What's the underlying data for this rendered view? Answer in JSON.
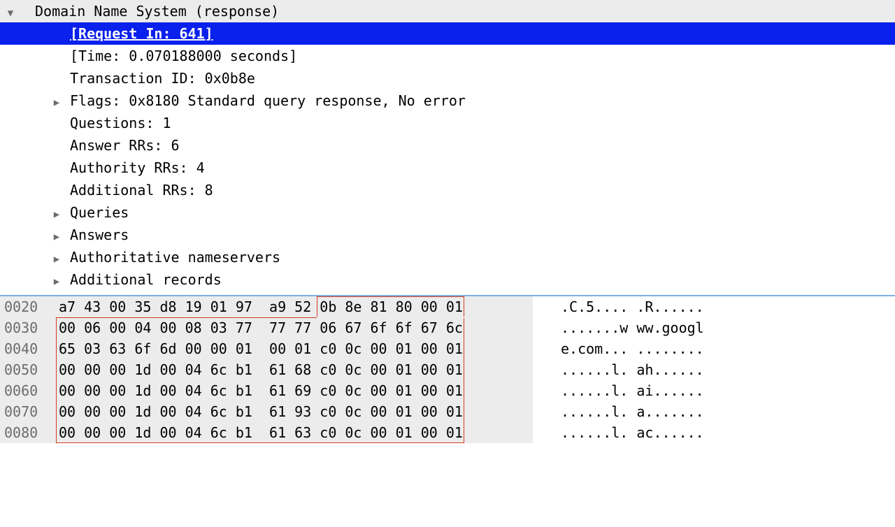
{
  "tree": {
    "header": "Domain Name System (response)",
    "request_in": "[Request In: 641]",
    "time": "[Time: 0.070188000 seconds]",
    "transaction_id": "Transaction ID: 0x0b8e",
    "flags": "Flags: 0x8180 Standard query response, No error",
    "questions": "Questions: 1",
    "answer_rrs": "Answer RRs: 6",
    "authority_rrs": "Authority RRs: 4",
    "additional_rrs": "Additional RRs: 8",
    "queries": "Queries",
    "answers": "Answers",
    "authoritative": "Authoritative nameservers",
    "additional": "Additional records"
  },
  "hex": {
    "rows": [
      {
        "offset": "0020",
        "bytes": "a7 43 00 35 d8 19 01 97  a9 52 0b 8e 81 80 00 01",
        "ascii": ".C.5.... .R......"
      },
      {
        "offset": "0030",
        "bytes": "00 06 00 04 00 08 03 77  77 77 06 67 6f 6f 67 6c",
        "ascii": ".......w ww.googl"
      },
      {
        "offset": "0040",
        "bytes": "65 03 63 6f 6d 00 00 01  00 01 c0 0c 00 01 00 01",
        "ascii": "e.com... ........"
      },
      {
        "offset": "0050",
        "bytes": "00 00 00 1d 00 04 6c b1  61 68 c0 0c 00 01 00 01",
        "ascii": "......l. ah......"
      },
      {
        "offset": "0060",
        "bytes": "00 00 00 1d 00 04 6c b1  61 69 c0 0c 00 01 00 01",
        "ascii": "......l. ai......"
      },
      {
        "offset": "0070",
        "bytes": "00 00 00 1d 00 04 6c b1  61 93 c0 0c 00 01 00 01",
        "ascii": "......l. a......."
      },
      {
        "offset": "0080",
        "bytes": "00 00 00 1d 00 04 6c b1  61 63 c0 0c 00 01 00 01",
        "ascii": "......l. ac......"
      }
    ]
  }
}
